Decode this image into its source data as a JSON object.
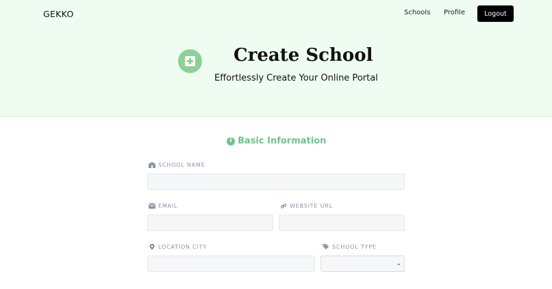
{
  "nav": {
    "brand": "GEKKO",
    "links": [
      "Schools",
      "Profile"
    ],
    "logout_label": "Logout"
  },
  "hero": {
    "icon": "plus-square-icon",
    "title": "Create School",
    "subtitle": "Effortlessly Create Your Online Portal",
    "background": "#effcf1",
    "icon_color": "#8ccf97"
  },
  "form": {
    "section_title": "Basic Information",
    "section_icon": "info-circle-icon",
    "accent": "#6cc58a",
    "fields": {
      "school_name": {
        "label": "SCHOOL NAME",
        "icon": "school-icon",
        "value": ""
      },
      "email": {
        "label": "EMAIL",
        "icon": "envelope-icon",
        "value": ""
      },
      "website_url": {
        "label": "WEBSITE URL",
        "icon": "link-icon",
        "value": ""
      },
      "location_city": {
        "label": "LOCATION CITY",
        "icon": "map-pin-icon",
        "value": ""
      },
      "school_type": {
        "label": "SCHOOL TYPE",
        "icon": "tags-icon",
        "value": ""
      }
    }
  }
}
